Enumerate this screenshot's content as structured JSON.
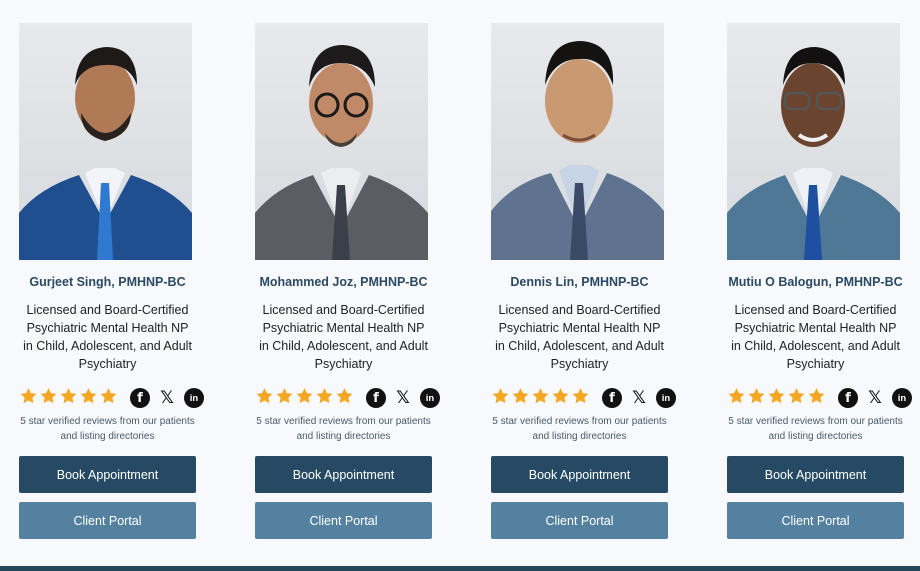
{
  "colors": {
    "name_text": "#2b4a63",
    "book_button": "#264a63",
    "portal_button": "#5581a0",
    "star": "#f5a623",
    "footer_bar": "#23465c"
  },
  "rating_stars": 5,
  "providers": [
    {
      "name": "Gurjeet Singh, PMHNP-BC",
      "description": "Licensed and Board-Certified Psychiatric Mental Health NP in Child, Adolescent, and Adult Psychiatry",
      "reviews": "5 star verified reviews from our patients and listing directories",
      "book_label": "Book Appointment",
      "portal_label": "Client Portal",
      "social_icons": [
        "facebook-icon",
        "x-icon",
        "linkedin-icon"
      ]
    },
    {
      "name": "Mohammed Joz, PMHNP-BC",
      "description": "Licensed and Board-Certified Psychiatric Mental Health NP in Child, Adolescent, and Adult Psychiatry",
      "reviews": "5 star verified reviews from our patients and listing directories",
      "book_label": "Book Appointment",
      "portal_label": "Client Portal",
      "social_icons": [
        "facebook-icon",
        "x-icon",
        "linkedin-icon"
      ]
    },
    {
      "name": "Dennis Lin, PMHNP-BC",
      "description": "Licensed and Board-Certified Psychiatric Mental Health NP in Child, Adolescent, and Adult Psychiatry",
      "reviews": "5 star verified reviews from our patients and listing directories",
      "book_label": "Book Appointment",
      "portal_label": "Client Portal",
      "social_icons": [
        "facebook-icon",
        "x-icon",
        "linkedin-icon"
      ]
    },
    {
      "name": "Mutiu O Balogun, PMHNP-BC",
      "description": "Licensed and Board-Certified Psychiatric Mental Health NP in Child, Adolescent, and Adult Psychiatry",
      "reviews": "5 star verified reviews from our patients and listing directories",
      "book_label": "Book Appointment",
      "portal_label": "Client Portal",
      "social_icons": [
        "facebook-icon",
        "x-icon",
        "linkedin-icon"
      ]
    }
  ]
}
